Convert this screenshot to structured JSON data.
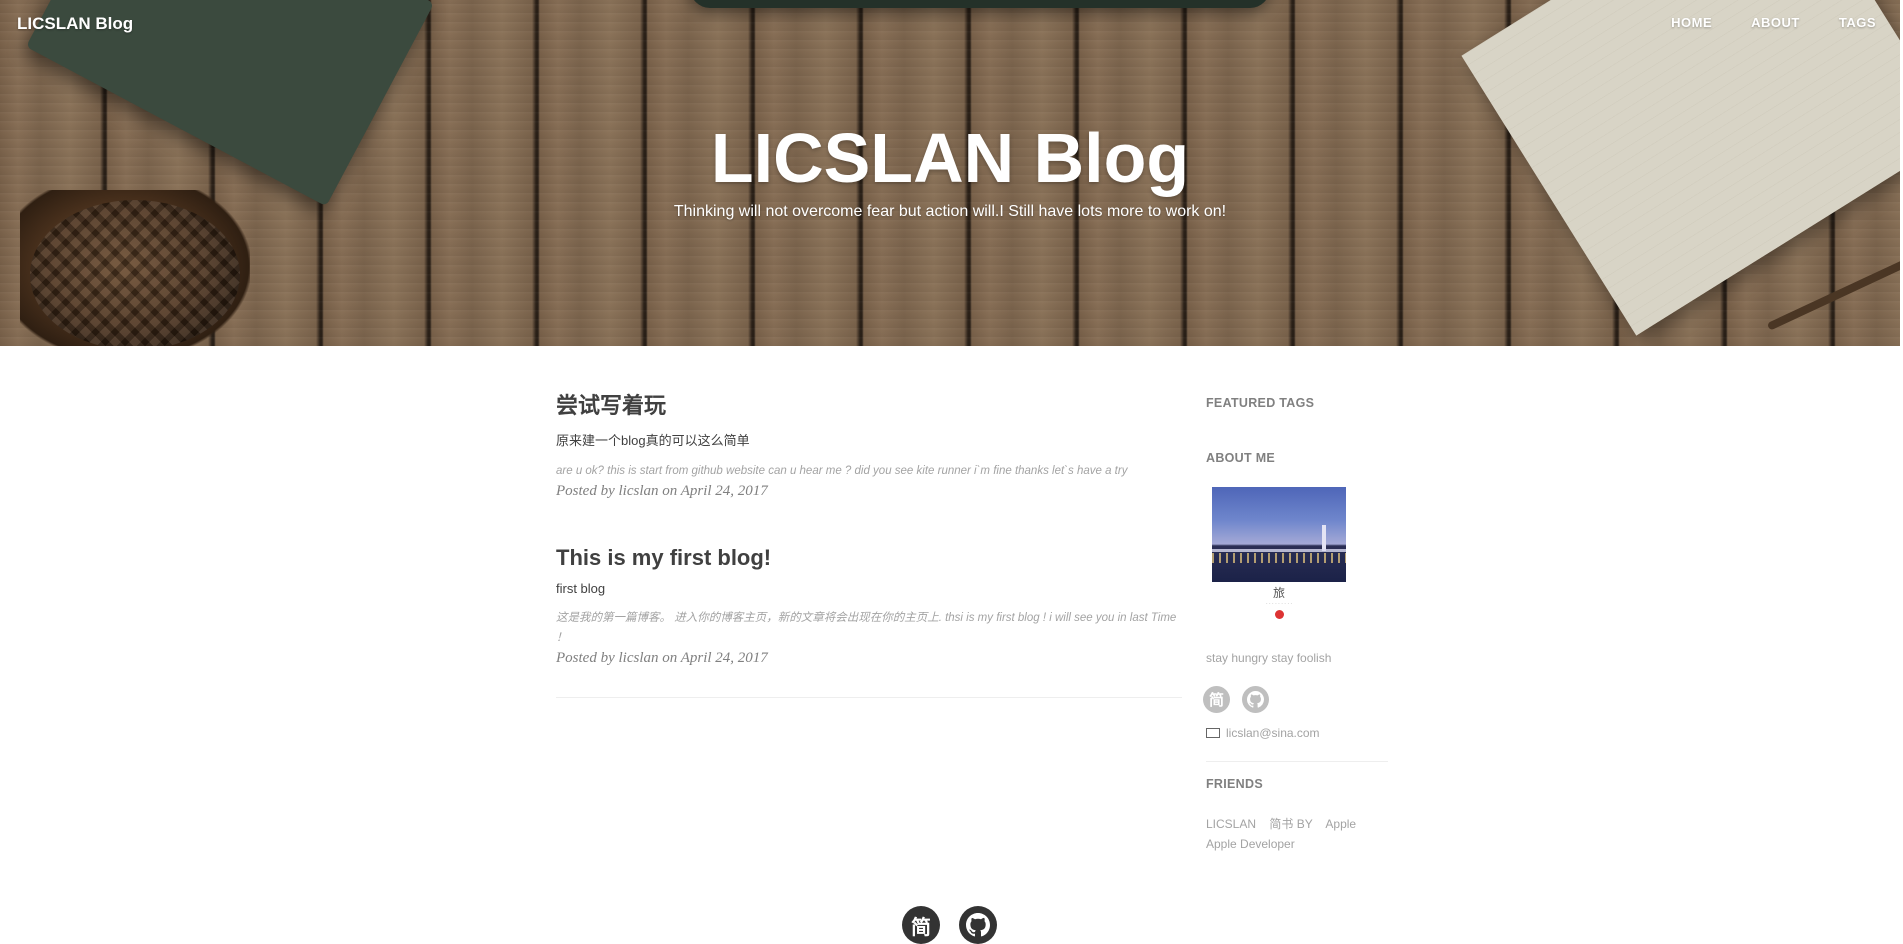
{
  "header": {
    "brand": "LICSLAN Blog",
    "nav": [
      "HOME",
      "ABOUT",
      "TAGS"
    ],
    "title": "LICSLAN Blog",
    "subtitle": "Thinking will not overcome fear but action will.I Still have lots more to work on!"
  },
  "posts": [
    {
      "title": "尝试写着玩",
      "subtitle": "原来建一个blog真的可以这么简单",
      "excerpt": "are u ok? this is start from github website can u hear me ? did you see kite runner i`m fine thanks let`s have a try",
      "meta": "Posted by licslan on April 24, 2017"
    },
    {
      "title": "This is my first blog!",
      "subtitle": "first blog",
      "excerpt": "这是我的第一篇博客。 进入你的博客主页，新的文章将会出现在你的主页上. thsi is my first blog ! i will see you in last Time ！",
      "meta": "Posted by licslan on April 24, 2017"
    }
  ],
  "sidebar": {
    "featured_tags": "FEATURED TAGS",
    "about_me": "ABOUT ME",
    "avatar_caption": "旅",
    "motto": "stay hungry stay foolish",
    "social": [
      {
        "icon": "jianshu-icon",
        "glyph": "简"
      },
      {
        "icon": "github-icon",
        "glyph": ""
      }
    ],
    "email": "licslan@sina.com",
    "friends_title": "FRIENDS",
    "friends": [
      "LICSLAN",
      "简书 BY",
      "Apple",
      "Apple Developer"
    ]
  },
  "footer": {
    "social": [
      {
        "icon": "jianshu-icon",
        "glyph": "简"
      },
      {
        "icon": "github-icon",
        "glyph": ""
      }
    ]
  }
}
